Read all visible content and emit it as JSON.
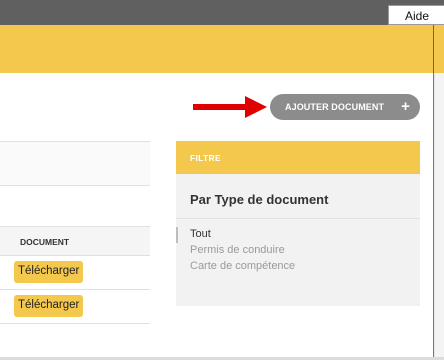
{
  "header": {
    "help_label": "Aide"
  },
  "toolbar": {
    "add_document_label": "AJOUTER DOCUMENT",
    "add_icon": "+"
  },
  "table": {
    "column_document": "DOCUMENT",
    "rows": [
      {
        "download_label": "Télécharger"
      },
      {
        "download_label": "Télécharger"
      }
    ]
  },
  "filter": {
    "header": "FILTRE",
    "title": "Par Type de document",
    "items": [
      {
        "label": "Tout",
        "active": true
      },
      {
        "label": "Permis de conduire",
        "active": false
      },
      {
        "label": "Carte de compétence",
        "active": false
      }
    ]
  },
  "colors": {
    "accent": "#f4c84c",
    "topbar": "#606060",
    "button_gray": "#8c8c8c",
    "arrow": "#e00000"
  }
}
